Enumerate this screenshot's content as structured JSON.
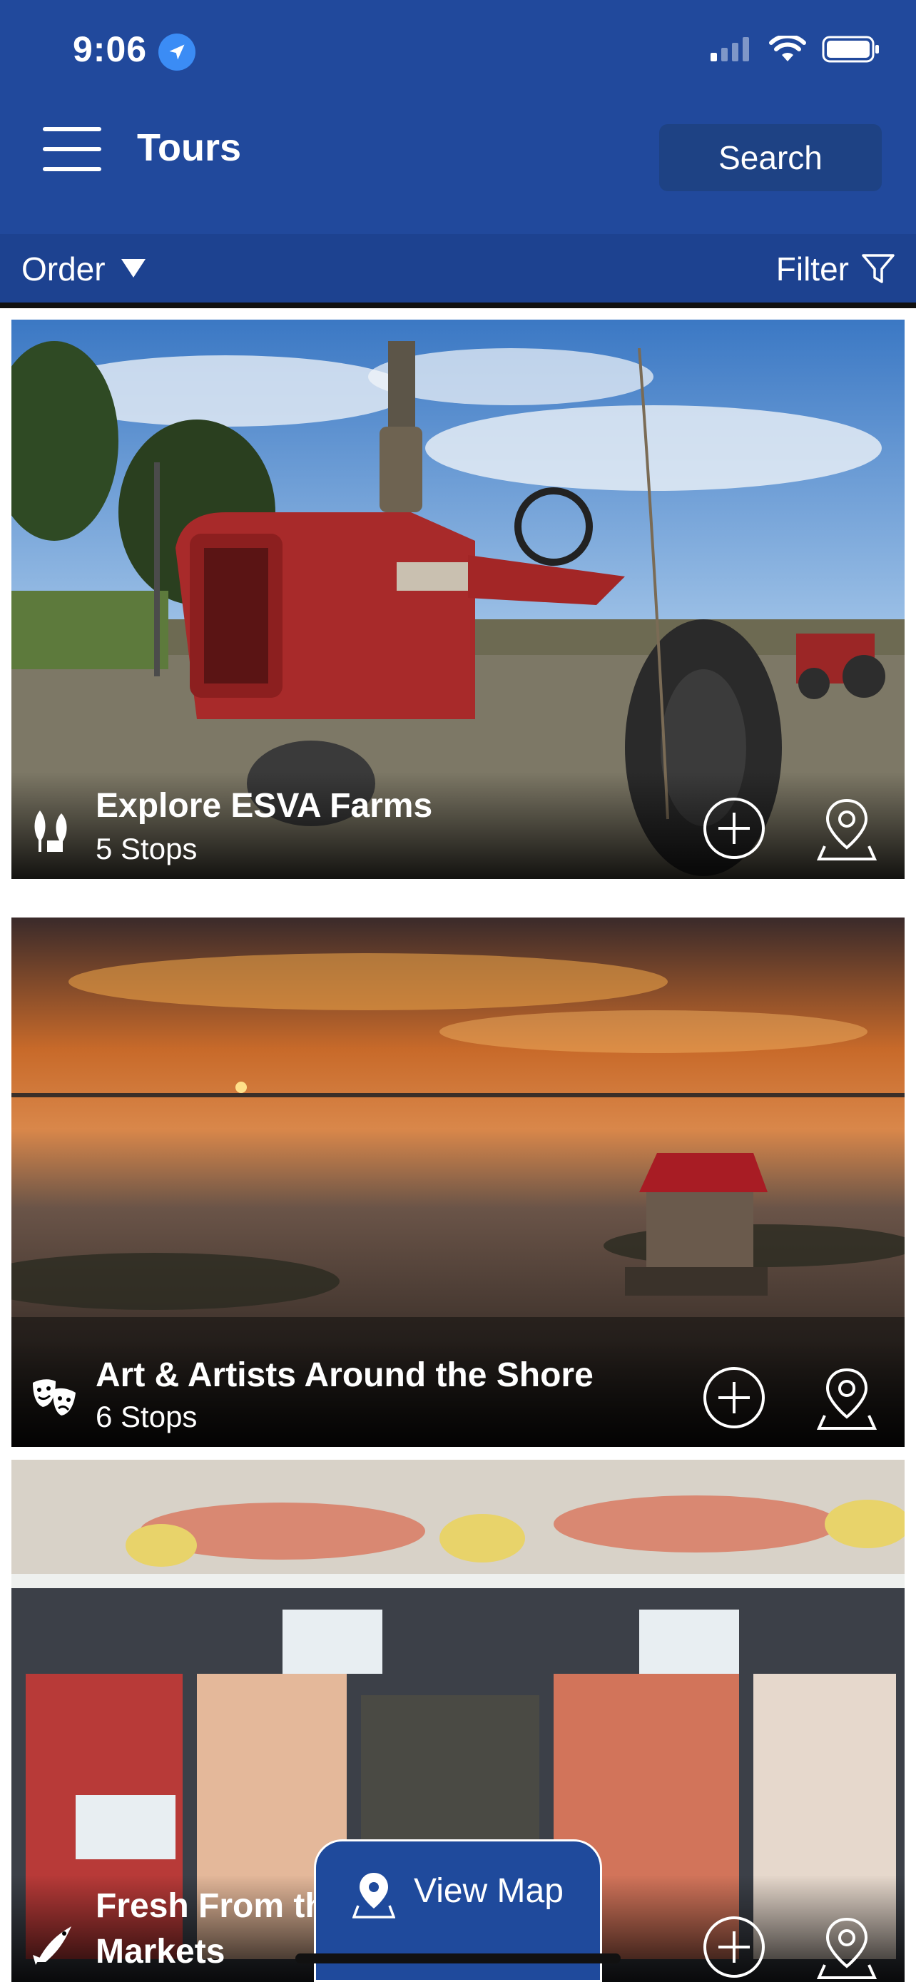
{
  "status": {
    "time": "9:06"
  },
  "header": {
    "title": "Tours",
    "search_label": "Search"
  },
  "toolbar": {
    "order_label": "Order",
    "filter_label": "Filter"
  },
  "tours": [
    {
      "title": "Explore ESVA Farms",
      "stops": "5 Stops",
      "icon": "farm-icon"
    },
    {
      "title": "Art & Artists Around the Shore",
      "stops": "6 Stops",
      "icon": "theater-masks-icon"
    },
    {
      "title": "Fresh From the Markets",
      "stops": "",
      "icon": "fish-icon"
    }
  ],
  "view_map_label": "View Map",
  "colors": {
    "header": "#21499c",
    "toolbar": "#1d4290",
    "accent": "#3b8cf5"
  }
}
